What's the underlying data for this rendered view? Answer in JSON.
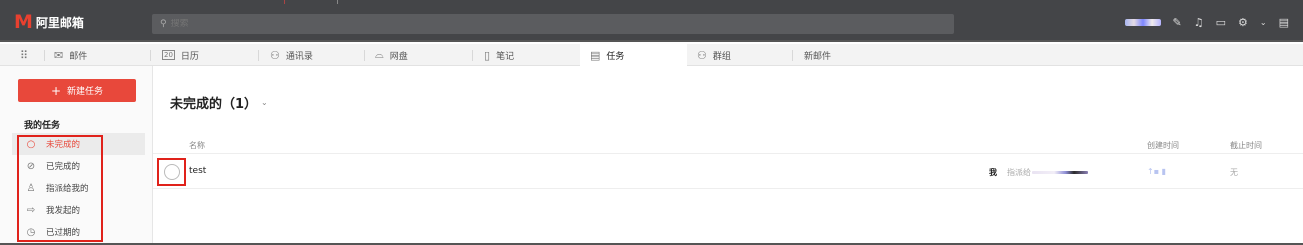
{
  "brand": {
    "logo_letter": "M",
    "name": "阿里邮箱"
  },
  "search": {
    "placeholder": "搜索"
  },
  "nav": {
    "items": [
      {
        "label": "邮件",
        "icon": "mail-icon"
      },
      {
        "label": "日历",
        "icon": "calendar-icon",
        "calendar_day": "20"
      },
      {
        "label": "通讯录",
        "icon": "contacts-icon"
      },
      {
        "label": "网盘",
        "icon": "drive-icon"
      },
      {
        "label": "笔记",
        "icon": "notes-icon"
      },
      {
        "label": "任务",
        "icon": "task-icon"
      },
      {
        "label": "群组",
        "icon": "group-icon"
      },
      {
        "label": "新邮件",
        "icon": ""
      }
    ],
    "active": "任务"
  },
  "sidebar": {
    "new_task": "新建任务",
    "new_task_symbol": "+",
    "section": "我的任务",
    "items": [
      {
        "label": "未完成的",
        "icon": "circle-icon",
        "active": true
      },
      {
        "label": "已完成的",
        "icon": "check-circle-icon"
      },
      {
        "label": "指派给我的",
        "icon": "user-icon"
      },
      {
        "label": "我发起的",
        "icon": "arrow-right-icon"
      },
      {
        "label": "已过期的",
        "icon": "clock-icon"
      }
    ]
  },
  "main": {
    "title": "未完成的（1）",
    "columns": {
      "name": "名称",
      "created": "创建时间",
      "deadline": "截止时间"
    },
    "rows": [
      {
        "name": "test",
        "assigner": "我",
        "assign_to_label": "指派给",
        "created": "↑▪ ▮",
        "deadline": "无"
      }
    ]
  },
  "colors": {
    "accent": "#e8483b",
    "topbar": "#444548",
    "highlight_box": "#e0221b"
  }
}
